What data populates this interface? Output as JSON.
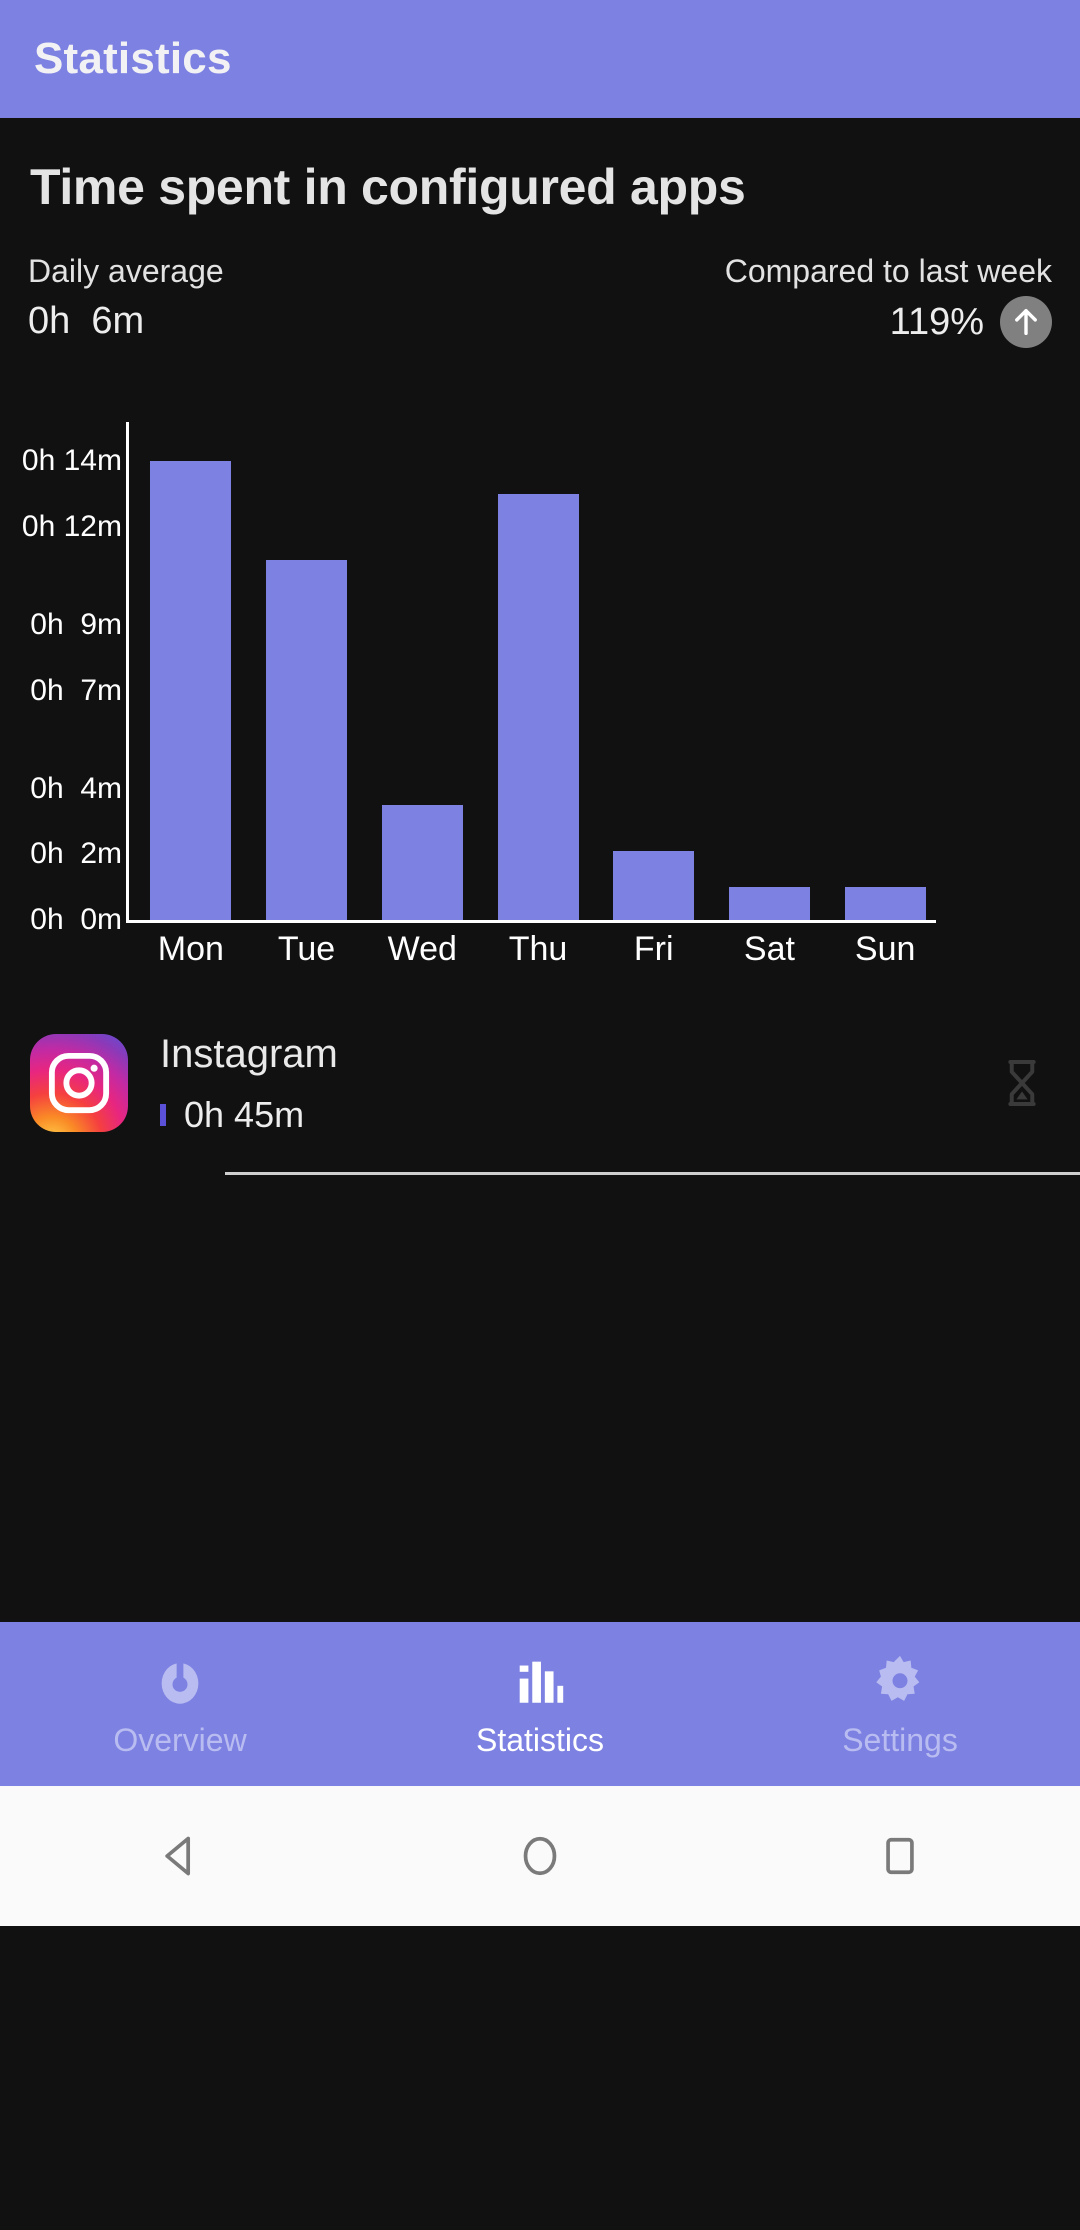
{
  "appbar": {
    "title": "Statistics"
  },
  "card": {
    "title": "Time spent in configured apps",
    "daily_average_label": "Daily average",
    "daily_average_value": "0h  6m",
    "compare_label": "Compared to last week",
    "compare_value": "119%",
    "trend_icon": "arrow-up-icon"
  },
  "chart_data": {
    "type": "bar",
    "title": "Time spent in configured apps",
    "xlabel": "",
    "ylabel": "",
    "categories": [
      "Mon",
      "Tue",
      "Wed",
      "Thu",
      "Fri",
      "Sat",
      "Sun"
    ],
    "values": [
      14,
      11,
      3.5,
      13,
      2.1,
      1,
      1
    ],
    "unit": "minutes",
    "ytick_labels": [
      "0h 14m",
      "0h 12m",
      "0h  9m",
      "0h  7m",
      "0h  4m",
      "0h  2m",
      "0h  0m"
    ],
    "ytick_values": [
      14,
      12,
      9,
      7,
      4,
      2,
      0
    ],
    "ylim": [
      0,
      15.2
    ],
    "grid": false,
    "legend": "none",
    "bar_color": "#7d81e2",
    "axis_color": "#ffffff"
  },
  "apps": [
    {
      "icon": "instagram-icon",
      "name": "Instagram",
      "time": "0h 45m",
      "action_icon": "hourglass-icon"
    }
  ],
  "bottom_nav": {
    "items": [
      {
        "label": "Overview",
        "icon": "timer-icon",
        "active": false
      },
      {
        "label": "Statistics",
        "icon": "bar-chart-icon",
        "active": true
      },
      {
        "label": "Settings",
        "icon": "gear-icon",
        "active": false
      }
    ]
  },
  "system_nav": {
    "back": "back-triangle-icon",
    "home": "home-circle-icon",
    "recents": "recents-square-icon"
  },
  "colors": {
    "accent": "#7d81e2",
    "background": "#111111",
    "text": "#ededed",
    "muted_nav_text": "#b9bcf0",
    "badge": "#808080"
  }
}
